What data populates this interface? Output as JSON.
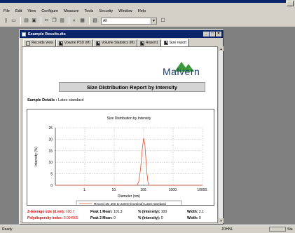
{
  "menu": [
    "File",
    "Edit",
    "View",
    "Configure",
    "Measure",
    "Tools",
    "Security",
    "Window",
    "Help"
  ],
  "toolbar": {
    "select_value": "All"
  },
  "window": {
    "title": "Example Results.dts"
  },
  "tabs": [
    {
      "label": "Records View",
      "active": false
    },
    {
      "label": "Volume PSD (M)",
      "active": false
    },
    {
      "label": "Volume Statistics (M)",
      "active": false
    },
    {
      "label": "Report1",
      "active": false
    },
    {
      "label": "Size report",
      "active": true
    }
  ],
  "report": {
    "logo_text": "Malvern",
    "title": "Size Distribution Report by Intensity",
    "sample_label": "Sample Details :",
    "sample_value": "Latex standard"
  },
  "chart_data": {
    "type": "line",
    "title": "Size Distribution by Intensity",
    "xlabel": "Diameter (nm)",
    "ylabel": "Intensity (%)",
    "xscale": "log",
    "xlim": [
      0.1,
      10000
    ],
    "x_ticks": [
      "1",
      "10",
      "100",
      "1000",
      "10000"
    ],
    "ylim": [
      0,
      25
    ],
    "y_ticks": [
      "0",
      "5",
      "10",
      "15",
      "20",
      "25"
    ],
    "grid": true,
    "series": [
      {
        "name": "Record 16: 200 to 220nm(nominal) Latex standard",
        "color": "#e0502a",
        "x": [
          0.1,
          60,
          70,
          80,
          90,
          100,
          110,
          120,
          130,
          140,
          150,
          10000
        ],
        "y": [
          0,
          0,
          2,
          8,
          16,
          20.5,
          18,
          11,
          5,
          1.5,
          0,
          0
        ]
      }
    ],
    "legend": "bottom"
  },
  "stats": {
    "z_avg_label": "Z-Average size (d.nm):",
    "z_avg_value": "100.7",
    "pdi_label": "Polydispersity index:",
    "pdi_value": "0.004565",
    "peak1_label": "Peak 1 Mean:",
    "peak1_value": "101.3",
    "peak2_label": "Peak 2 Mean:",
    "peak2_value": "0",
    "int1_label": "% (intensity):",
    "int1_value": "100",
    "int2_label": "% (intensity):",
    "int2_value": "0",
    "width1_label": "Width:",
    "width1_value": "2.1",
    "width2_label": "Width:",
    "width2_value": "0"
  },
  "statusbar": {
    "left": "Ready",
    "user": "JOHNL",
    "end": "Sta"
  }
}
